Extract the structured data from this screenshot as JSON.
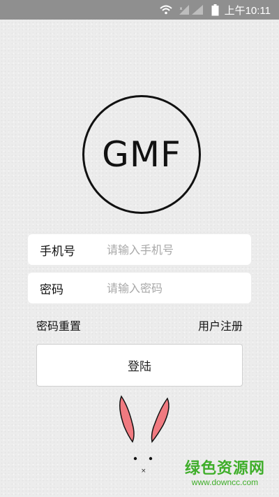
{
  "status_bar": {
    "wifi_icon": "wifi-icon",
    "signal_icon": "signal-icon",
    "battery_icon": "battery-icon",
    "time": "上午10:11"
  },
  "logo": {
    "text": "GMF"
  },
  "form": {
    "phone_label": "手机号",
    "phone_placeholder": "请输入手机号",
    "password_label": "密码",
    "password_placeholder": "请输入密码"
  },
  "links": {
    "reset": "密码重置",
    "register": "用户注册"
  },
  "login_button": "登陆",
  "colors": {
    "bunny_ear": "#f07a80",
    "watermark": "#3fae2a"
  },
  "watermark": {
    "title": "绿色资源网",
    "url": "www.downcc.com"
  }
}
